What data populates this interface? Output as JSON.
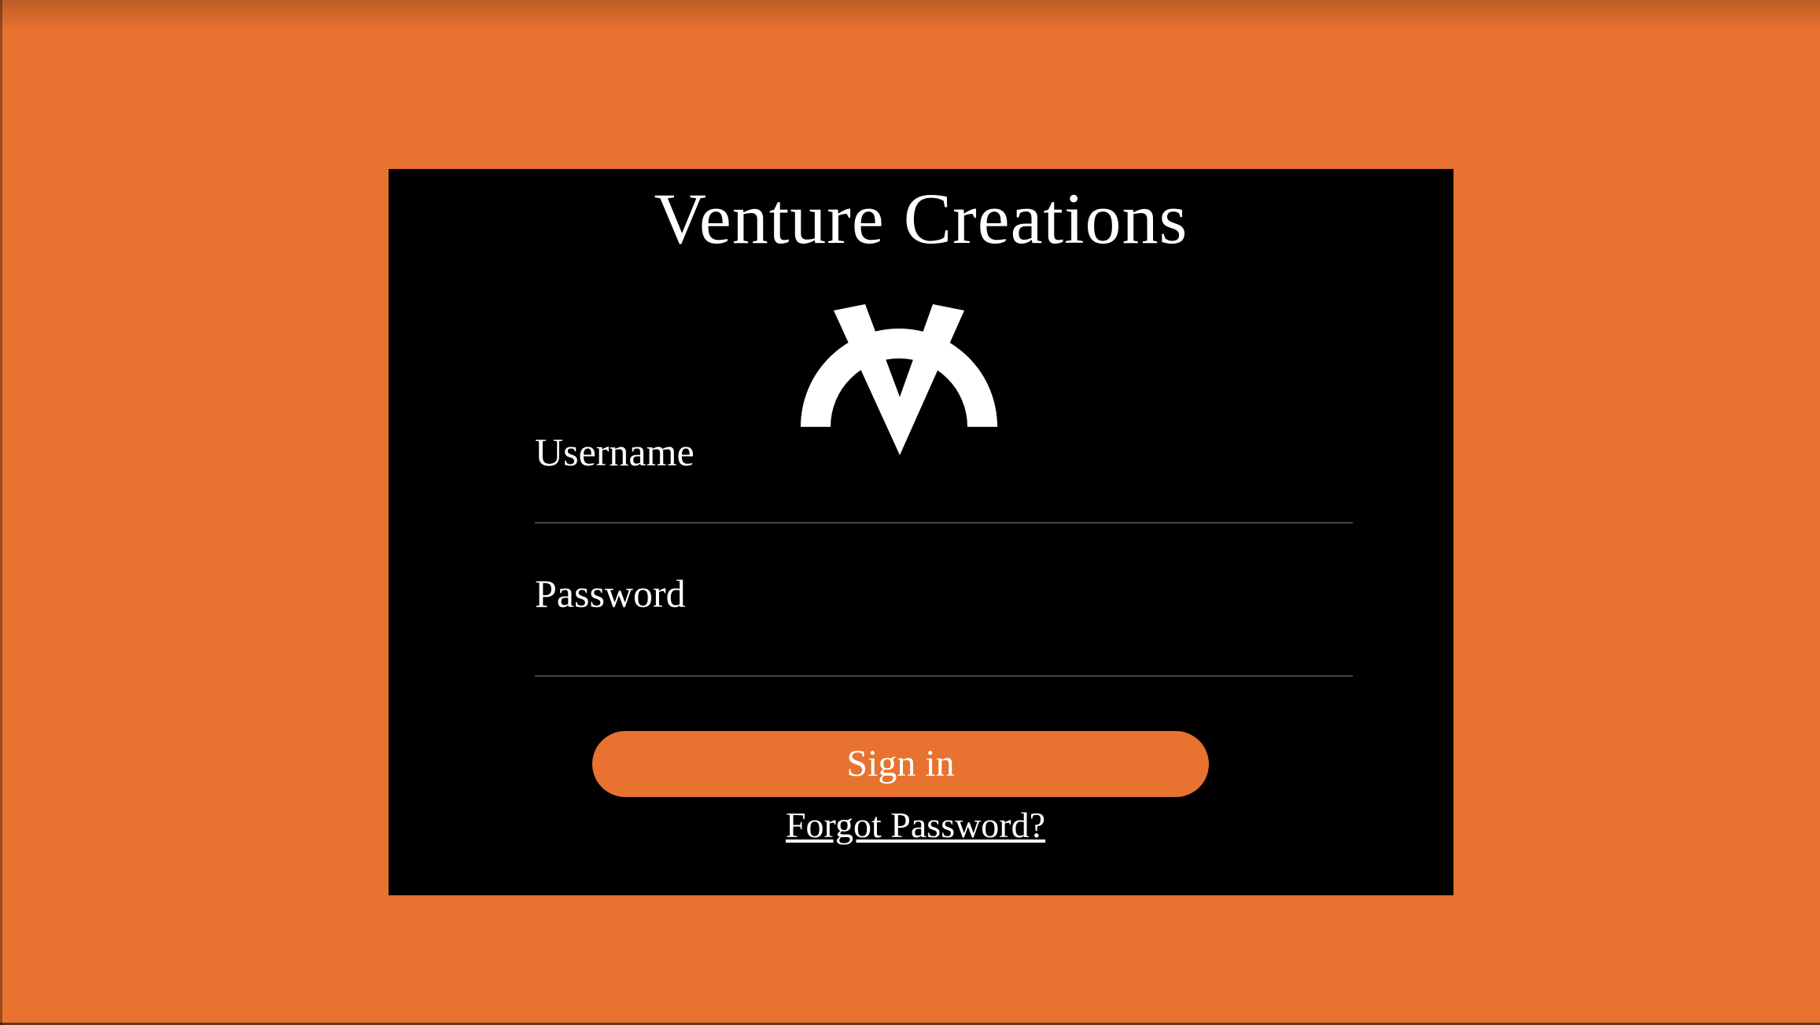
{
  "brand": {
    "title": "Venture Creations",
    "logo_icon": "venture-creations-v-logo"
  },
  "form": {
    "username_label": "Username",
    "username_value": "",
    "password_label": "Password",
    "password_value": "",
    "signin_label": "Sign in",
    "forgot_label": "Forgot Password?"
  },
  "colors": {
    "background": "#E8722F",
    "card": "#000000",
    "button": "#E8722F",
    "text": "#FFFFFF"
  }
}
